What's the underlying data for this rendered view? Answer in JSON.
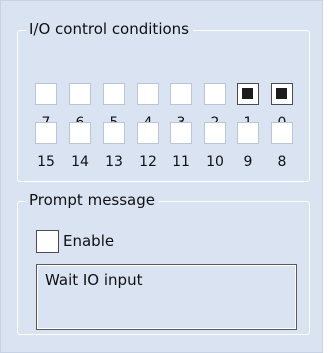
{
  "io_group": {
    "title": "I/O control conditions",
    "row1": [
      {
        "label": "7",
        "checked": false
      },
      {
        "label": "6",
        "checked": false
      },
      {
        "label": "5",
        "checked": false
      },
      {
        "label": "4",
        "checked": false
      },
      {
        "label": "3",
        "checked": false
      },
      {
        "label": "2",
        "checked": false
      },
      {
        "label": "1",
        "checked": true
      },
      {
        "label": "0",
        "checked": true
      }
    ],
    "row2": [
      {
        "label": "15",
        "checked": false
      },
      {
        "label": "14",
        "checked": false
      },
      {
        "label": "13",
        "checked": false
      },
      {
        "label": "12",
        "checked": false
      },
      {
        "label": "11",
        "checked": false
      },
      {
        "label": "10",
        "checked": false
      },
      {
        "label": "9",
        "checked": false
      },
      {
        "label": "8",
        "checked": false
      }
    ]
  },
  "prompt_group": {
    "title": "Prompt message",
    "enable_label": "Enable",
    "enable_checked": false,
    "message": "Wait IO input"
  }
}
